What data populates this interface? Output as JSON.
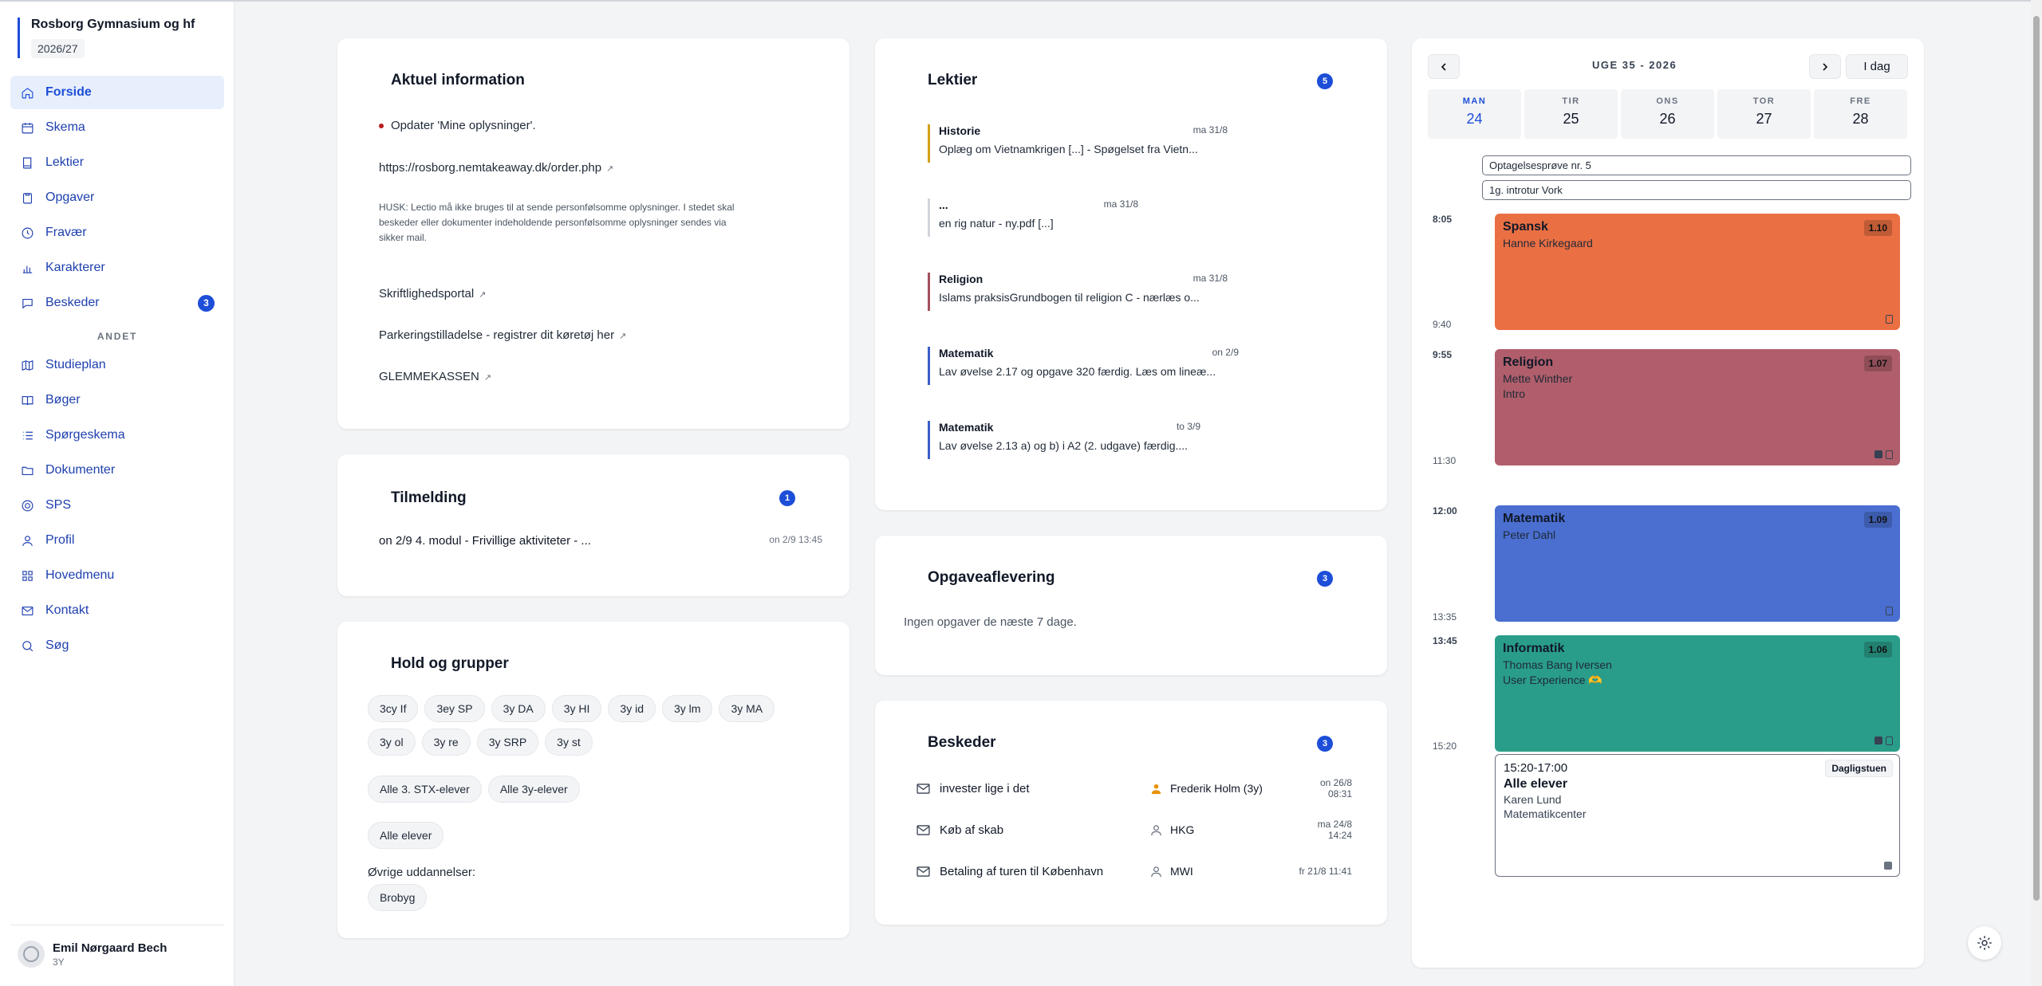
{
  "school": {
    "name": "Rosborg Gymnasium og hf",
    "year": "2026/27"
  },
  "nav": {
    "items": [
      {
        "label": "Forside",
        "icon": "home-icon",
        "active": true
      },
      {
        "label": "Skema",
        "icon": "calendar-icon"
      },
      {
        "label": "Lektier",
        "icon": "book-icon"
      },
      {
        "label": "Opgaver",
        "icon": "clipboard-icon"
      },
      {
        "label": "Fravær",
        "icon": "clock-icon"
      },
      {
        "label": "Karakterer",
        "icon": "bar-chart-icon"
      },
      {
        "label": "Beskeder",
        "icon": "message-icon",
        "badge": "3"
      }
    ],
    "section_label": "ANDET",
    "other_items": [
      {
        "label": "Studieplan",
        "icon": "map-icon"
      },
      {
        "label": "Bøger",
        "icon": "book-open-icon"
      },
      {
        "label": "Spørgeskema",
        "icon": "list-icon"
      },
      {
        "label": "Dokumenter",
        "icon": "folder-icon"
      },
      {
        "label": "SPS",
        "icon": "lifebuoy-icon"
      },
      {
        "label": "Profil",
        "icon": "user-icon"
      },
      {
        "label": "Hovedmenu",
        "icon": "grid-icon"
      },
      {
        "label": "Kontakt",
        "icon": "mail-icon"
      },
      {
        "label": "Søg",
        "icon": "search-icon"
      }
    ]
  },
  "user": {
    "name": "Emil Nørgaard Bech",
    "class": "3Y"
  },
  "aktuel": {
    "title": "Aktuel information",
    "update": "Opdater 'Mine oplysninger'.",
    "link": "https://rosborg.nemtakeaway.dk/order.php",
    "husk": "HUSK: Lectio må ikke bruges til at sende personfølsomme oplysninger. I stedet skal beskeder eller dokumenter indeholdende personfølsomme oplysninger sendes via sikker mail.",
    "links": [
      "Skriftlighedsportal",
      "Parkeringstilladelse - registrer dit køretøj her",
      "GLEMMEKASSEN"
    ],
    "ext_symbol": "↗"
  },
  "tilmelding": {
    "title": "Tilmelding",
    "count": "1",
    "item": "on 2/9 4. modul - Frivillige aktiviteter - ...",
    "date": "on 2/9 13:45"
  },
  "hold": {
    "title": "Hold og grupper",
    "row1": [
      "3cy If",
      "3ey SP",
      "3y DA",
      "3y HI",
      "3y id",
      "3y lm",
      "3y MA",
      "3y ol",
      "3y re",
      "3y SRP",
      "3y st"
    ],
    "row2": [
      "Alle 3. STX-elever",
      "Alle 3y-elever"
    ],
    "row3": [
      "Alle elever"
    ],
    "other_label": "Øvrige uddannelser:",
    "other": [
      "Brobyg"
    ]
  },
  "lektier": {
    "title": "Lektier",
    "count": "5",
    "items": [
      {
        "subject": "Historie",
        "date": "ma 31/8",
        "text": "Oplæg om Vietnamkrigen [...] - Spøgelset fra Vietn...",
        "color": "#d4a017"
      },
      {
        "subject": "...",
        "date": "ma 31/8",
        "text": "en rig natur - ny.pdf [...]",
        "color": "#d1d5db"
      },
      {
        "subject": "Religion",
        "date": "ma 31/8",
        "text": "Islams praksisGrundbogen til religion C - nærlæs o...",
        "color": "#a4505d"
      },
      {
        "subject": "Matematik",
        "date": "on 2/9",
        "text": "Lav øvelse 2.17 og opgave 320 færdig. Læs om lineæ...",
        "color": "#3b5fc8"
      },
      {
        "subject": "Matematik",
        "date": "to 3/9",
        "text": "Lav øvelse 2.13 a) og b) i A2 (2. udgave) færdig....",
        "color": "#3b5fc8"
      }
    ]
  },
  "opgave": {
    "title": "Opgaveaflevering",
    "count": "3",
    "empty": "Ingen opgaver de næste 7 dage."
  },
  "beskeder": {
    "title": "Beskeder",
    "count": "3",
    "items": [
      {
        "subject": "invester lige i det",
        "sender": "Frederik Holm (3y)",
        "date": "on 26/8 08:31",
        "sender_color": "#e8900c"
      },
      {
        "subject": "Køb af skab",
        "sender": "HKG",
        "date": "ma 24/8 14:24",
        "sender_color": "#6b7280"
      },
      {
        "subject": "Betaling af turen til København",
        "sender": "MWI",
        "date": "fr 21/8 11:41",
        "sender_color": "#6b7280"
      }
    ]
  },
  "calendar": {
    "week_label": "UGE 35 - 2026",
    "today_label": "I dag",
    "days": [
      {
        "name": "MAN",
        "num": "24"
      },
      {
        "name": "TIR",
        "num": "25"
      },
      {
        "name": "ONS",
        "num": "26"
      },
      {
        "name": "TOR",
        "num": "27"
      },
      {
        "name": "FRE",
        "num": "28"
      }
    ],
    "allday": [
      "Optagelsesprøve nr. 5",
      "1g. introtur Vork"
    ],
    "lessons": [
      {
        "title": "Spansk",
        "teacher": "Hanne Kirkegaard",
        "note": "",
        "room": "1.10",
        "start": "8:05",
        "end": "9:40",
        "color": "#ea6f43"
      },
      {
        "title": "Religion",
        "teacher": "Mette Winther",
        "note": "Intro",
        "room": "1.07",
        "start": "9:55",
        "end": "11:30",
        "color": "#b05e6b"
      },
      {
        "title": "Matematik",
        "teacher": "Peter Dahl",
        "note": "",
        "room": "1.09",
        "start": "12:00",
        "end": "13:35",
        "color": "#4a6fd1"
      },
      {
        "title": "Informatik",
        "teacher": "Thomas Bang Iversen",
        "note": "User Experience 🫶",
        "room": "1.06",
        "start": "13:45",
        "end": "15:20",
        "color": "#2a9d8a"
      }
    ],
    "event": {
      "time": "15:20-17:00",
      "title": "Alle elever",
      "teacher": "Karen Lund",
      "place": "Matematikcenter",
      "location": "Dagligstuen"
    }
  }
}
